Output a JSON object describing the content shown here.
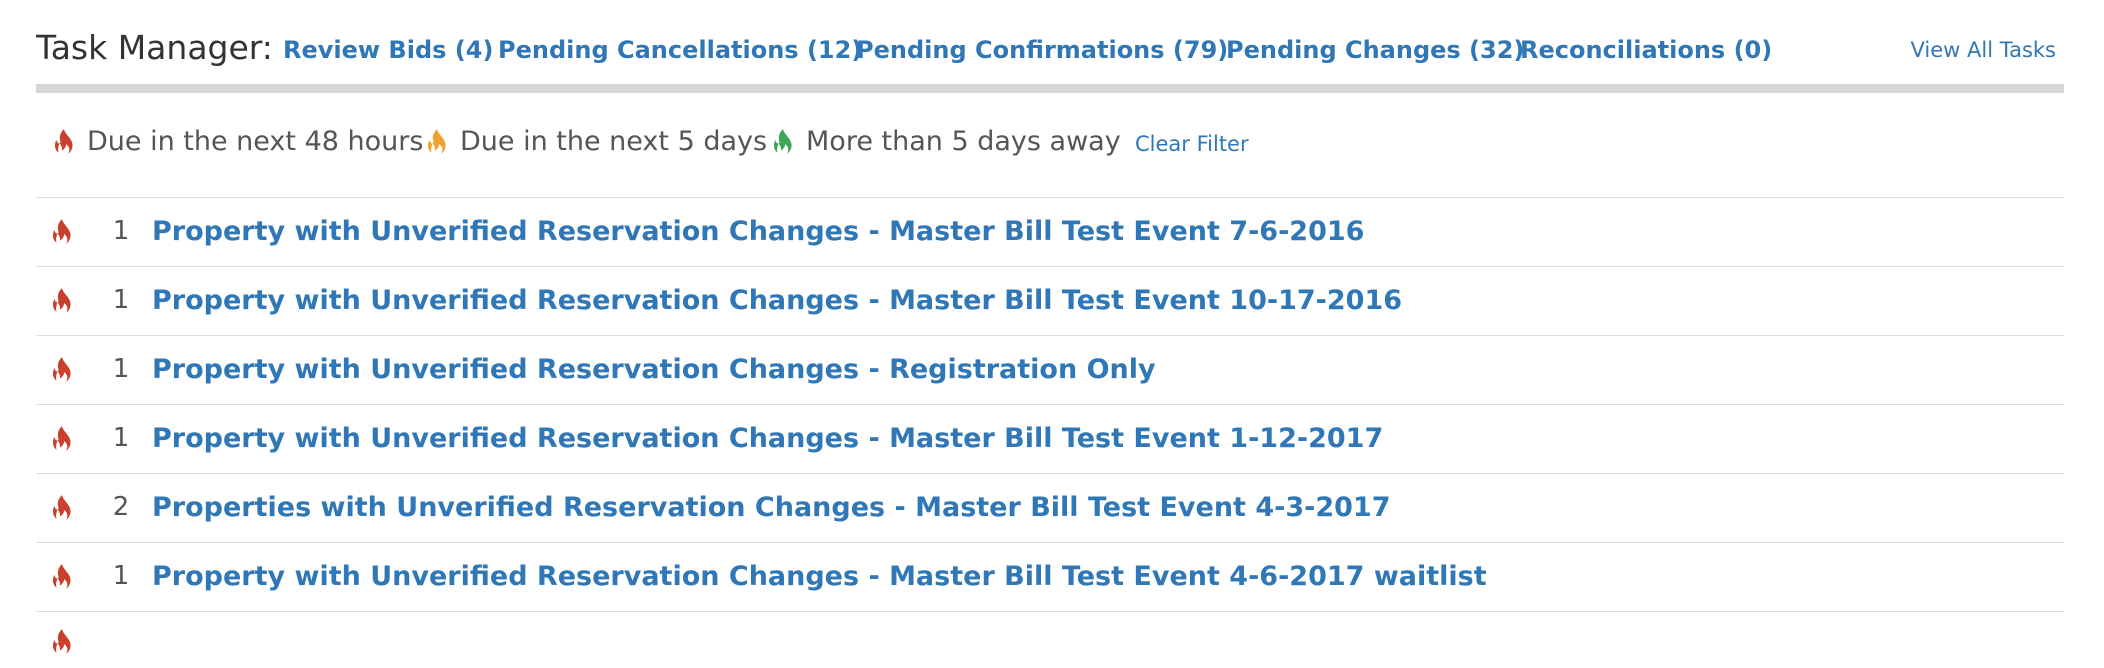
{
  "header": {
    "title": "Task Manager:",
    "tabs": [
      {
        "label": "Review Bids (4)"
      },
      {
        "label": "Pending Cancellations (12)"
      },
      {
        "label": "Pending Confirmations (79)"
      },
      {
        "label": "Pending Changes (32)"
      },
      {
        "label": "Reconciliations (0)"
      }
    ],
    "view_all_label": "View All Tasks"
  },
  "legend": {
    "items": [
      {
        "label": "Due in the next 48 hours",
        "icon": "flame-icon",
        "color": "#c9402e"
      },
      {
        "label": "Due in the next 5 days",
        "icon": "flame-icon",
        "color": "#f0a22e"
      },
      {
        "label": "More than 5 days away",
        "icon": "flame-icon",
        "color": "#3aa658"
      }
    ],
    "clear_filter_label": "Clear Filter"
  },
  "colors": {
    "link": "#2f77b6",
    "urgent": "#c9402e",
    "soon": "#f0a22e",
    "later": "#3aa658",
    "divider": "#d6d6d6"
  },
  "tasks": [
    {
      "count": "1",
      "label": "Property with Unverified Reservation Changes - Master Bill Test Event 7-6-2016",
      "icon": "flame-icon",
      "urgency": "urgent"
    },
    {
      "count": "1",
      "label": "Property with Unverified Reservation Changes - Master Bill Test Event 10-17-2016",
      "icon": "flame-icon",
      "urgency": "urgent"
    },
    {
      "count": "1",
      "label": "Property with Unverified Reservation Changes - Registration Only",
      "icon": "flame-icon",
      "urgency": "urgent"
    },
    {
      "count": "1",
      "label": "Property with Unverified Reservation Changes - Master Bill Test Event 1-12-2017",
      "icon": "flame-icon",
      "urgency": "urgent"
    },
    {
      "count": "2",
      "label": "Properties with Unverified Reservation Changes - Master Bill Test Event 4-3-2017",
      "icon": "flame-icon",
      "urgency": "urgent"
    },
    {
      "count": "1",
      "label": "Property with Unverified Reservation Changes - Master Bill Test Event 4-6-2017 waitlist",
      "icon": "flame-icon",
      "urgency": "urgent"
    }
  ]
}
